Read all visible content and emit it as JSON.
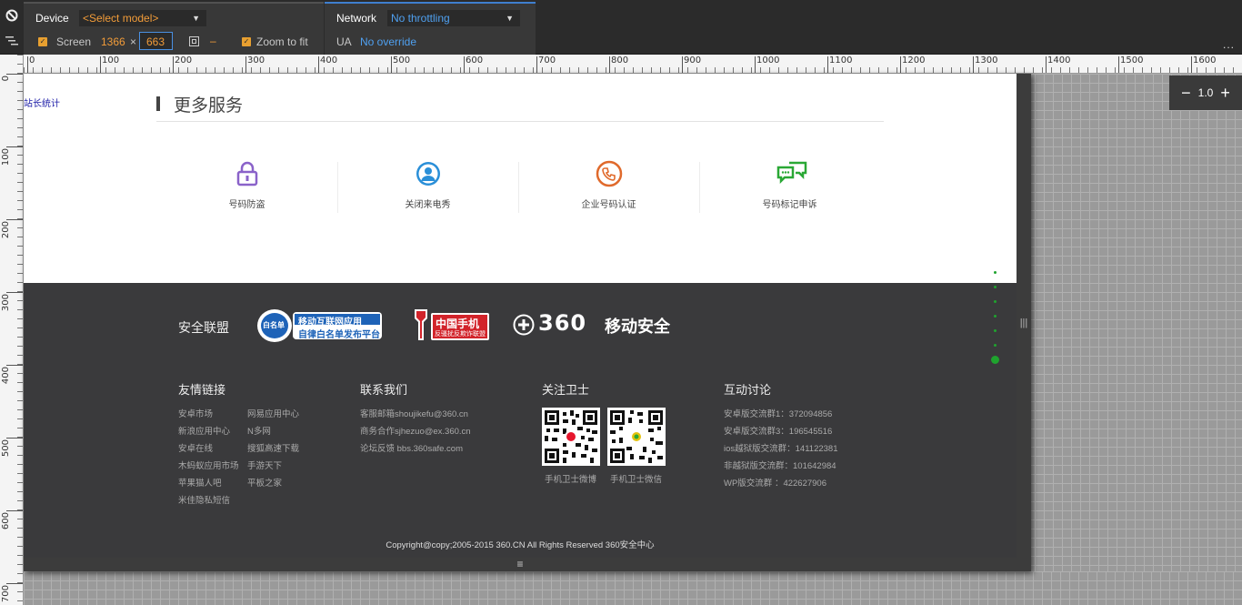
{
  "toolbar": {
    "device_label": "Device",
    "device_select": "<Select model>",
    "screen_label": "Screen",
    "screen_width": "1366",
    "screen_times": "×",
    "screen_height": "663",
    "swap_dash": "–",
    "zoom_to_fit": "Zoom to fit",
    "network_label": "Network",
    "network_select": "No throttling",
    "ua_label": "UA",
    "ua_value": "No override",
    "more": "..."
  },
  "ruler": {
    "top": [
      "0",
      "100",
      "200",
      "300",
      "400",
      "500",
      "600",
      "700",
      "800",
      "900",
      "1000",
      "1100",
      "1200",
      "1300",
      "1400",
      "1500",
      "1600"
    ],
    "left": [
      "0",
      "100",
      "200",
      "300",
      "400",
      "500",
      "600",
      "700"
    ]
  },
  "zoom": {
    "minus": "−",
    "value": "1.0",
    "plus": "+"
  },
  "page": {
    "stat_link": "站长统计",
    "section_title": "更多服务",
    "services": [
      {
        "label": "号码防盗",
        "icon": "lock-icon",
        "color": "#8a62c9"
      },
      {
        "label": "关闭来电秀",
        "icon": "user-circle-icon",
        "color": "#2a8fd8"
      },
      {
        "label": "企业号码认证",
        "icon": "phone-verify-icon",
        "color": "#e06a2c"
      },
      {
        "label": "号码标记申诉",
        "icon": "chat-bubbles-icon",
        "color": "#2aa835"
      }
    ]
  },
  "footer": {
    "alliance_title": "安全联盟",
    "logo1_badge": "白名单",
    "logo1_line1": "移动互联网应用",
    "logo1_line2": "自律白名单发布平台",
    "logo2_line1": "中国手机",
    "logo2_line2": "反骚扰反欺诈联盟",
    "logo3_num": "360",
    "logo3_text": "移动安全",
    "friend_title": "友情链接",
    "friend_col1": [
      "安卓市场",
      "新浪应用中心",
      "安卓在线",
      "木蚂蚁应用市场",
      "苹果猫人吧",
      "米佳隐私短信"
    ],
    "friend_col2": [
      "网易应用中心",
      "N多网",
      "搜狐高速下载",
      "手游天下",
      "平板之家"
    ],
    "contact_title": "联系我们",
    "contact": [
      "客服邮箱shoujikefu@360.cn",
      "商务合作sjhezuo@ex.360.cn",
      "论坛反馈 bbs.360safe.com"
    ],
    "follow_title": "关注卫士",
    "qr_weibo": "手机卫士微博",
    "qr_weixin": "手机卫士微信",
    "discuss_title": "互动讨论",
    "discuss": [
      "安卓版交流群1：372094856",
      "安卓版交流群3：196545516",
      "ios越狱版交流群：141122381",
      "非越狱版交流群：101642984",
      "WP版交流群 ：422627906"
    ],
    "copyright": "Copyright@copy;2005-2015 360.CN All Rights Reserved 360安全中心"
  },
  "colors": {
    "accent_orange": "#f29c39",
    "accent_blue": "#4fa0f0",
    "footer_bg": "#3a3a3c",
    "nav_dot": "#1fa32e"
  }
}
